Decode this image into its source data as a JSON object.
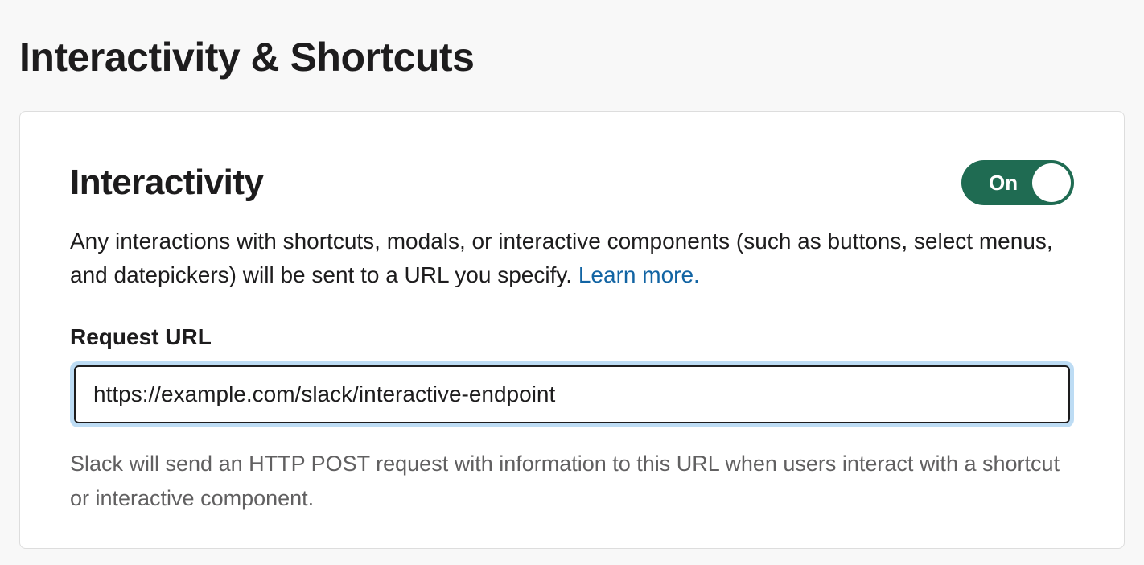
{
  "page": {
    "title": "Interactivity & Shortcuts"
  },
  "section": {
    "title": "Interactivity",
    "toggle_label": "On",
    "description_text": "Any interactions with shortcuts, modals, or interactive components (such as buttons, select menus, and datepickers) will be sent to a URL you specify. ",
    "learn_more": "Learn more."
  },
  "request_url": {
    "label": "Request URL",
    "value": "https://example.com/slack/interactive-endpoint",
    "helper": "Slack will send an HTTP POST request with information to this URL when users interact with a shortcut or interactive component."
  }
}
